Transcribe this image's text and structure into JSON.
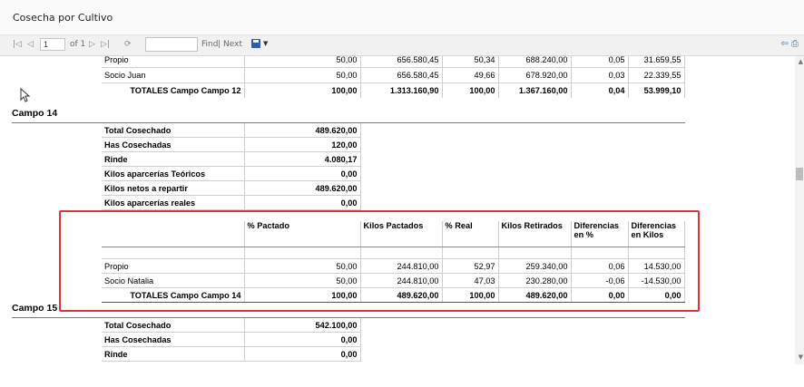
{
  "window": {
    "title": "Cosecha por Cultivo"
  },
  "toolbar": {
    "page_value": "1",
    "of_label": "of 1",
    "find_label": "Find",
    "separator": "|",
    "next_label": "Next"
  },
  "campo12": {
    "rows": [
      {
        "name": "Propio",
        "pct": "50,00",
        "kp": "656.580,45",
        "real": "50,34",
        "kr": "688.240,00",
        "dif_pct": "0,05",
        "dif_kg": "31.659,55"
      },
      {
        "name": "Socio Juan",
        "pct": "50,00",
        "kp": "656.580,45",
        "real": "49,66",
        "kr": "678.920,00",
        "dif_pct": "0,03",
        "dif_kg": "22.339,55"
      }
    ],
    "totals": {
      "name": "TOTALES Campo Campo 12",
      "pct": "100,00",
      "kp": "1.313.160,90",
      "real": "100,00",
      "kr": "1.367.160,00",
      "dif_pct": "0,04",
      "dif_kg": "53.999,10"
    }
  },
  "campo14": {
    "header": "Campo 14",
    "summary": [
      {
        "label": "Total Cosechado",
        "value": "489.620,00"
      },
      {
        "label": "Has Cosechadas",
        "value": "120,00"
      },
      {
        "label": "Rinde",
        "value": "4.080,17"
      },
      {
        "label": "Kilos aparcerías Teóricos",
        "value": "0,00"
      },
      {
        "label": "Kilos netos a repartir",
        "value": "489.620,00"
      },
      {
        "label": "Kilos aparcerías reales",
        "value": "0,00"
      }
    ],
    "columns": {
      "pct": "% Pactado",
      "kp": "Kilos Pactados",
      "real": "% Real",
      "kr": "Kilos Retirados",
      "dif_pct": "Diferencias en %",
      "dif_kg": "Diferencias en Kilos"
    },
    "rows": [
      {
        "name": "Propio",
        "pct": "50,00",
        "kp": "244.810,00",
        "real": "52,97",
        "kr": "259.340,00",
        "dif_pct": "0,06",
        "dif_kg": "14.530,00"
      },
      {
        "name": "Socio Natalia",
        "pct": "50,00",
        "kp": "244.810,00",
        "real": "47,03",
        "kr": "230.280,00",
        "dif_pct": "-0,06",
        "dif_kg": "-14.530,00"
      }
    ],
    "totals": {
      "name": "TOTALES Campo Campo 14",
      "pct": "100,00",
      "kp": "489.620,00",
      "real": "100,00",
      "kr": "489.620,00",
      "dif_pct": "0,00",
      "dif_kg": "0,00"
    }
  },
  "campo15": {
    "header": "Campo 15",
    "summary": [
      {
        "label": "Total Cosechado",
        "value": "542.100,00"
      },
      {
        "label": "Has Cosechadas",
        "value": "0,00"
      },
      {
        "label": "Rinde",
        "value": "0,00"
      }
    ]
  },
  "icons": {
    "first_page": "first-page-icon",
    "prev_page": "prev-page-icon",
    "next_page": "next-page-icon",
    "last_page": "last-page-icon",
    "refresh": "refresh-icon",
    "save": "save-icon",
    "back": "back-icon",
    "print": "print-icon"
  },
  "colors": {
    "highlight_box": "#d9363a",
    "save_icon": "#2d5fa8"
  }
}
